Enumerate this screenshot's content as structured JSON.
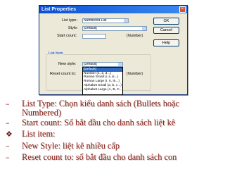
{
  "dialog": {
    "title": "List Properties",
    "fields": {
      "list_type": {
        "label": "List type:",
        "value": "Numbered List"
      },
      "style": {
        "label": "Style:",
        "value": "[Default]"
      },
      "start_count": {
        "label": "Start count:",
        "value": "",
        "hint": "(Number)"
      },
      "list_item_group": "List item",
      "new_style": {
        "label": "New style:",
        "value": "[Default]"
      },
      "reset_count": {
        "label": "Reset count to:",
        "hint": "(Number)"
      }
    },
    "buttons": {
      "ok": "OK",
      "cancel": "Cancel",
      "help": "Help"
    },
    "dropdown_options": [
      "[Default]",
      "Number (1, 2, 3...)",
      "Roman Small (i, ii, iii...)",
      "Roman Large (I, II, III...)",
      "Alphabet Small (a, b, c...)",
      "Alphabet Large (A, B, C...)"
    ]
  },
  "bullets": [
    {
      "marker": "–",
      "text": "List Type: Chọn kiểu danh sách (Bullets hoặc Numbered)"
    },
    {
      "marker": "–",
      "text": "Start count: Số bắt đầu cho danh sách liệt kê"
    },
    {
      "marker": "❖",
      "text": "List item:"
    },
    {
      "marker": "–",
      "text": "New Style: liệt kê nhiều cấp"
    },
    {
      "marker": "–",
      "text": "Reset count to: số bắt đầu cho danh sách con"
    }
  ],
  "colors": {
    "text": "#8b1e16",
    "titlebar": "#0a4fd4",
    "dialog_bg": "#ece9d8"
  }
}
